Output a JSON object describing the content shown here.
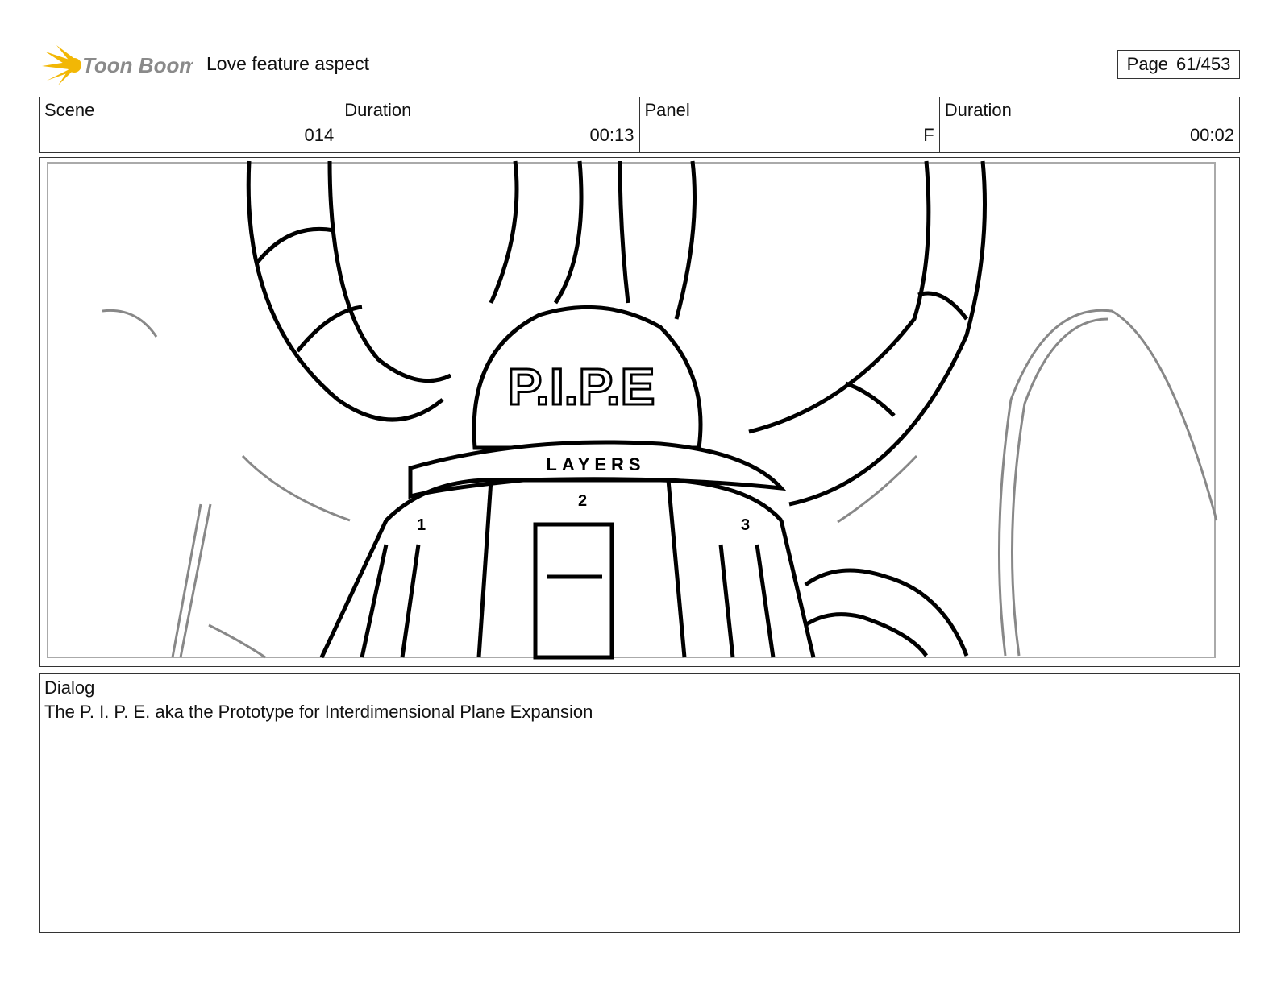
{
  "header": {
    "brand": "Toon Boom",
    "project_title": "Love feature aspect",
    "page_label": "Page",
    "page_number": "61/453"
  },
  "info": {
    "scene_label": "Scene",
    "scene_value": "014",
    "scene_duration_label": "Duration",
    "scene_duration_value": "00:13",
    "panel_label": "Panel",
    "panel_value": "F",
    "panel_duration_label": "Duration",
    "panel_duration_value": "00:02"
  },
  "panel_art": {
    "sign_main": "P.I.P.E",
    "sign_band": "LAYERS",
    "door_numbers": [
      "1",
      "2",
      "3"
    ]
  },
  "dialog": {
    "label": "Dialog",
    "text": "The P. I. P. E. aka the Prototype for Interdimensional Plane Expansion"
  }
}
